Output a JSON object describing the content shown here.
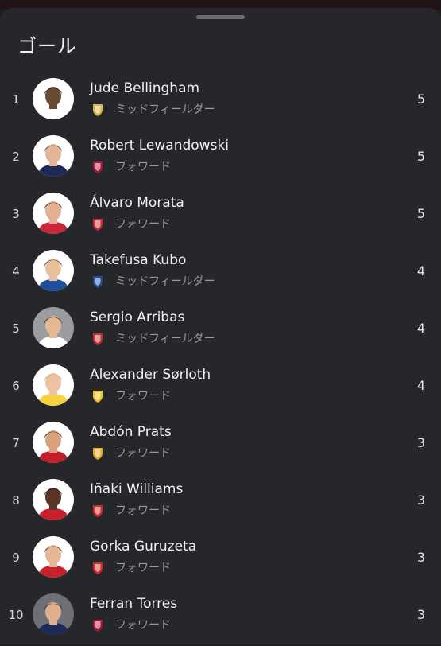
{
  "header": {
    "title": "ゴール"
  },
  "players": [
    {
      "rank": "1",
      "name": "Jude Bellingham",
      "position": "ミッドフィールダー",
      "goals": "5",
      "club_icon": "real-madrid-crest-icon",
      "skin": "#6b4a34",
      "hair": "#1c1410",
      "shirt": "#ffffff",
      "avatar_bg": "#ffffff",
      "crest_color": "#d8b54a"
    },
    {
      "rank": "2",
      "name": "Robert Lewandowski",
      "position": "フォワード",
      "goals": "5",
      "club_icon": "barcelona-crest-icon",
      "skin": "#e3b597",
      "hair": "#4a3a2c",
      "shirt": "#1d2a57",
      "avatar_bg": "#ffffff",
      "crest_color": "#a5183a"
    },
    {
      "rank": "3",
      "name": "Álvaro Morata",
      "position": "フォワード",
      "goals": "5",
      "club_icon": "atletico-madrid-crest-icon",
      "skin": "#e2b194",
      "hair": "#2a1e18",
      "shirt": "#c8283a",
      "avatar_bg": "#ffffff",
      "crest_color": "#cc2a36"
    },
    {
      "rank": "4",
      "name": "Takefusa Kubo",
      "position": "ミッドフィールダー",
      "goals": "4",
      "club_icon": "real-sociedad-crest-icon",
      "skin": "#e8c09c",
      "hair": "#3a2a1f",
      "shirt": "#1f4f9a",
      "avatar_bg": "#ffffff",
      "crest_color": "#1f4f9a"
    },
    {
      "rank": "5",
      "name": "Sergio Arribas",
      "position": "ミッドフィールダー",
      "goals": "4",
      "club_icon": "almeria-crest-icon",
      "skin": "#e5b894",
      "hair": "#241a14",
      "shirt": "#ffffff",
      "avatar_bg": "#9b9ca0",
      "crest_color": "#c63030"
    },
    {
      "rank": "6",
      "name": "Alexander Sørloth",
      "position": "フォワード",
      "goals": "4",
      "club_icon": "villarreal-crest-icon",
      "skin": "#ecc2a3",
      "hair": "#c9a56a",
      "shirt": "#f6d33c",
      "avatar_bg": "#ffffff",
      "crest_color": "#f2c21b"
    },
    {
      "rank": "7",
      "name": "Abdón Prats",
      "position": "フォワード",
      "goals": "3",
      "club_icon": "mallorca-crest-icon",
      "skin": "#d9a27e",
      "hair": "#2a1c14",
      "shirt": "#c21f2b",
      "avatar_bg": "#ffffff",
      "crest_color": "#e8a820"
    },
    {
      "rank": "8",
      "name": "Iñaki Williams",
      "position": "フォワード",
      "goals": "3",
      "club_icon": "athletic-club-crest-icon",
      "skin": "#5a3626",
      "hair": "#1a1210",
      "shirt": "#c8202c",
      "avatar_bg": "#ffffff",
      "crest_color": "#d42a2a"
    },
    {
      "rank": "9",
      "name": "Gorka Guruzeta",
      "position": "フォワード",
      "goals": "3",
      "club_icon": "athletic-club-crest-icon",
      "skin": "#e6b796",
      "hair": "#3a2a1f",
      "shirt": "#c8202c",
      "avatar_bg": "#ffffff",
      "crest_color": "#d42a2a"
    },
    {
      "rank": "10",
      "name": "Ferran Torres",
      "position": "フォワード",
      "goals": "3",
      "club_icon": "barcelona-crest-icon",
      "skin": "#e0b08e",
      "hair": "#2a1e16",
      "shirt": "#1d2a57",
      "avatar_bg": "#6f7075",
      "crest_color": "#a5183a"
    }
  ]
}
